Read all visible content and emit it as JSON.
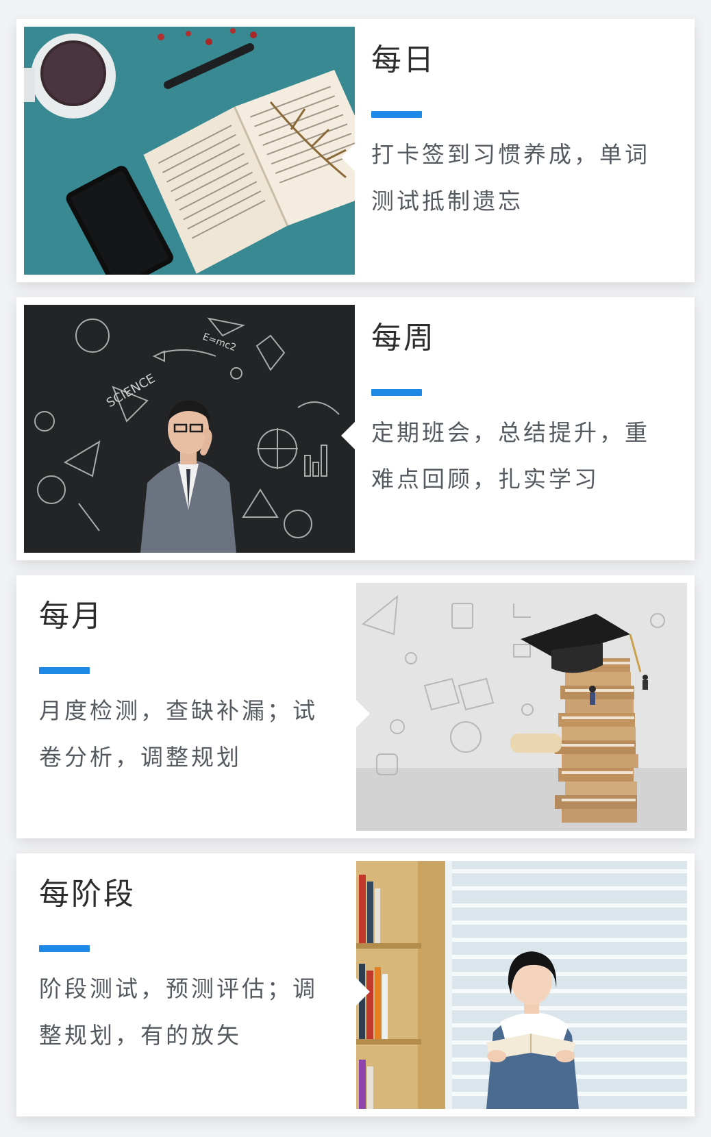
{
  "cards": [
    {
      "title": "每日",
      "description": "打卡签到习惯养成，单词测试抵制遗忘",
      "image": "book-coffee-phone-photo"
    },
    {
      "title": "每周",
      "description": "定期班会，总结提升，重难点回顾，扎实学习",
      "image": "teacher-chalkboard-photo"
    },
    {
      "title": "每月",
      "description": "月度检测，查缺补漏；试卷分析，调整规划",
      "image": "graduation-books-photo"
    },
    {
      "title": "每阶段",
      "description": "阶段测试，预测评估；调整规划，有的放矢",
      "image": "girl-reading-library-photo"
    }
  ],
  "colors": {
    "accent": "#1e88e5",
    "background": "#f1f2f4",
    "card": "#ffffff",
    "title": "#2d2d2d",
    "text": "#555a60"
  }
}
